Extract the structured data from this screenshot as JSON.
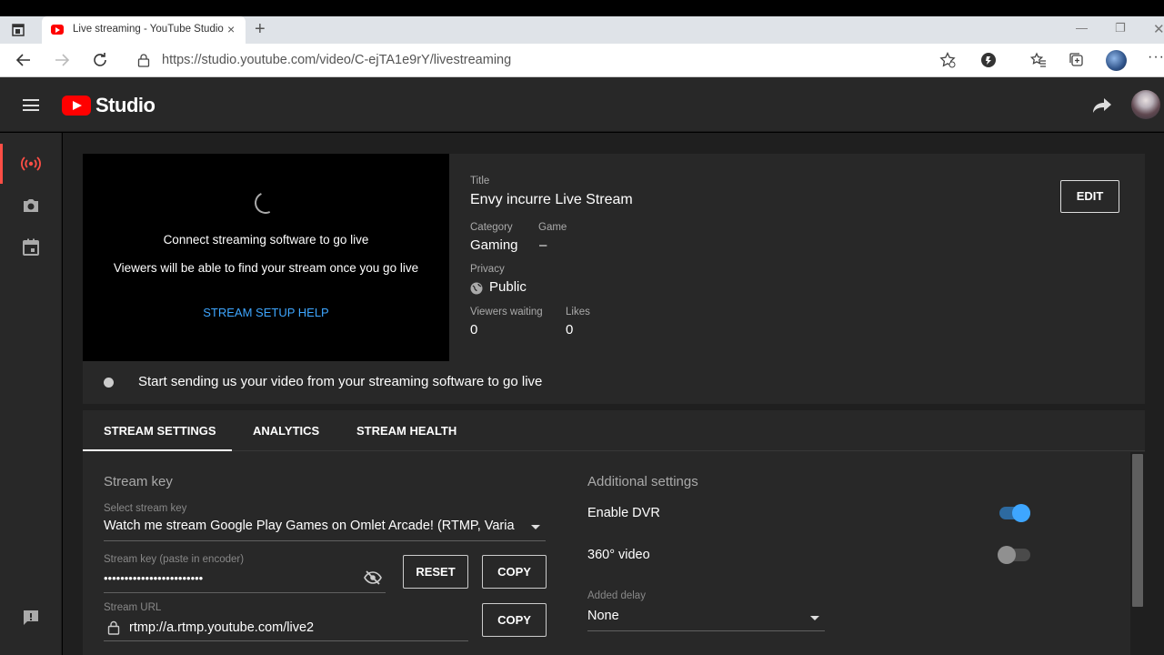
{
  "browser": {
    "tab_title": "Live streaming - YouTube Studio",
    "tab_close": "×",
    "new_tab": "+",
    "url": "https://studio.youtube.com/video/C-ejTA1e9rY/livestreaming",
    "window_min": "—",
    "window_max": "❐",
    "window_close": "✕",
    "menu_dots": "···"
  },
  "header": {
    "logo_text": "Studio"
  },
  "preview": {
    "line1": "Connect streaming software to go live",
    "line2": "Viewers will be able to find your stream once you go live",
    "help_link": "STREAM SETUP HELP"
  },
  "details": {
    "title_label": "Title",
    "title_value": "Envy incurre Live Stream",
    "category_label": "Category",
    "category_value": "Gaming",
    "game_label": "Game",
    "game_value": "–",
    "privacy_label": "Privacy",
    "privacy_value": "Public",
    "viewers_label": "Viewers waiting",
    "viewers_value": "0",
    "likes_label": "Likes",
    "likes_value": "0",
    "edit_label": "EDIT"
  },
  "status": {
    "message": "Start sending us your video from your streaming software to go live"
  },
  "tabs": [
    {
      "label": "STREAM SETTINGS",
      "active": true
    },
    {
      "label": "ANALYTICS",
      "active": false
    },
    {
      "label": "STREAM HEALTH",
      "active": false
    }
  ],
  "stream_key": {
    "section_title": "Stream key",
    "select_label": "Select stream key",
    "select_value": "Watch me stream Google Play Games on Omlet Arcade! (RTMP, Varia",
    "key_label": "Stream key (paste in encoder)",
    "key_value": "••••••••••••••••••••••••",
    "reset_label": "RESET",
    "copy_label": "COPY",
    "url_label": "Stream URL",
    "url_value": "rtmp://a.rtmp.youtube.com/live2",
    "url_copy_label": "COPY"
  },
  "additional": {
    "section_title": "Additional settings",
    "dvr_label": "Enable DVR",
    "dvr_on": true,
    "video360_label": "360° video",
    "video360_on": false,
    "delay_label": "Added delay",
    "delay_value": "None"
  },
  "colors": {
    "accent_blue": "#3ea6ff",
    "youtube_red": "#ff0000",
    "live_red": "#ff4e45"
  }
}
